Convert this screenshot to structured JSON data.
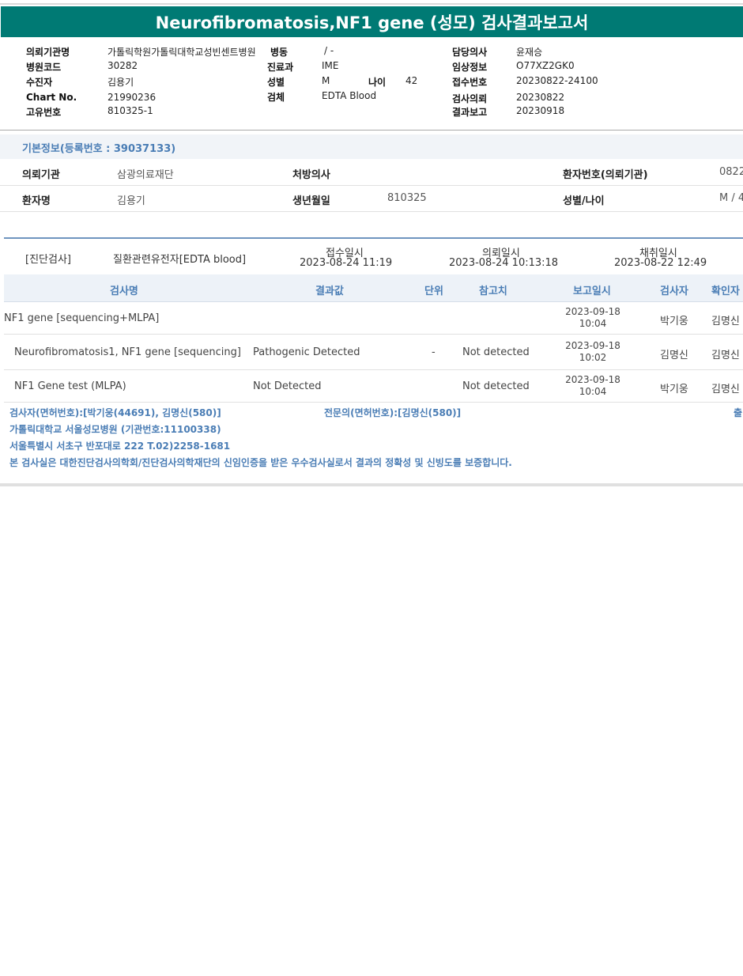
{
  "title": "Neurofibromatosis,NF1 gene (성모) 검사결과보고서",
  "header": {
    "institution_label": "의뢰기관명",
    "institution_value": "가톨릭학원가톨릭대학교성빈센트병원",
    "ward_label": "병동",
    "ward_value": "/ -",
    "doctor_label": "담당의사",
    "doctor_value": "윤재승",
    "hospital_code_label": "병원코드",
    "hospital_code_value": "30282",
    "dept_label": "진료과",
    "dept_value": "IME",
    "clinical_label": "임상정보",
    "clinical_value": "O77XZ2GK0",
    "patient_label": "수진자",
    "patient_value": "김용기",
    "sex_label": "성별",
    "sex_value": "M",
    "age_label": "나이",
    "age_value": "42",
    "receipt_label": "접수번호",
    "receipt_value": "20230822-24100",
    "chart_label": "Chart No.",
    "chart_value": "21990236",
    "specimen_label": "검체",
    "specimen_value": "EDTA Blood",
    "request_label": "검사의뢰",
    "request_value": "20230822",
    "unique_label": "고유번호",
    "unique_value": "810325-1",
    "report_label": "결과보고",
    "report_value": "20230918"
  },
  "basic_info": {
    "title": "기본정보(등록번호 : 39037133)",
    "org_label": "의뢰기관",
    "org_value": "삼광의료재단",
    "prescriber_label": "처방의사",
    "prescriber_value": "",
    "patient_no_label": "환자번호(의뢰기관)",
    "patient_no_value": "0822",
    "name_label": "환자명",
    "name_value": "김용기",
    "dob_label": "생년월일",
    "dob_value": "810325",
    "sexage_label": "성별/나이",
    "sexage_value": "M / 4"
  },
  "request": {
    "category": "[진단검사]",
    "test": "질환관련유전자[EDTA blood]",
    "received_label": "접수일시",
    "received_value": "2023-08-24 11:19",
    "requested_label": "의뢰일시",
    "requested_value": "2023-08-24 10:13:18",
    "collected_label": "채취일시",
    "collected_value": "2023-08-22 12:49"
  },
  "table": {
    "headers": [
      "검사명",
      "결과값",
      "단위",
      "참고치",
      "보고일시",
      "검사자",
      "확인자"
    ],
    "rows": [
      {
        "name": "NF1 gene [sequencing+MLPA]",
        "result": "",
        "unit": "",
        "ref": "",
        "date": "2023-09-18",
        "time": "10:04",
        "tester": "박기웅",
        "confirmer": "김명신"
      },
      {
        "name": "Neurofibromatosis1, NF1 gene [sequencing]",
        "result": "Pathogenic Detected",
        "unit": "-",
        "ref": "Not detected",
        "date": "2023-09-18",
        "time": "10:02",
        "tester": "김명신",
        "confirmer": "김명신"
      },
      {
        "name": "NF1 Gene test (MLPA)",
        "result": "Not Detected",
        "unit": "",
        "ref": "Not detected",
        "date": "2023-09-18",
        "time": "10:04",
        "tester": "박기웅",
        "confirmer": "김명신"
      }
    ]
  },
  "footer": {
    "testers": "검사자(면허번호):[박기웅(44691), 김명신(580)]",
    "specialist": "전문의(면허번호):[김명신(580)]",
    "right_char": "출",
    "lab_name": "가톨릭대학교 서울성모병원 (기관번호:11100338)",
    "address": "서울특별시 서초구 반포대로 222 T.02)2258-1681",
    "certification": "본 검사실은 대한진단검사의학회/진단검사의학재단의 신임인증을 받은 우수검사실로서 결과의 정확성 및 신빙도를 보증합니다."
  }
}
